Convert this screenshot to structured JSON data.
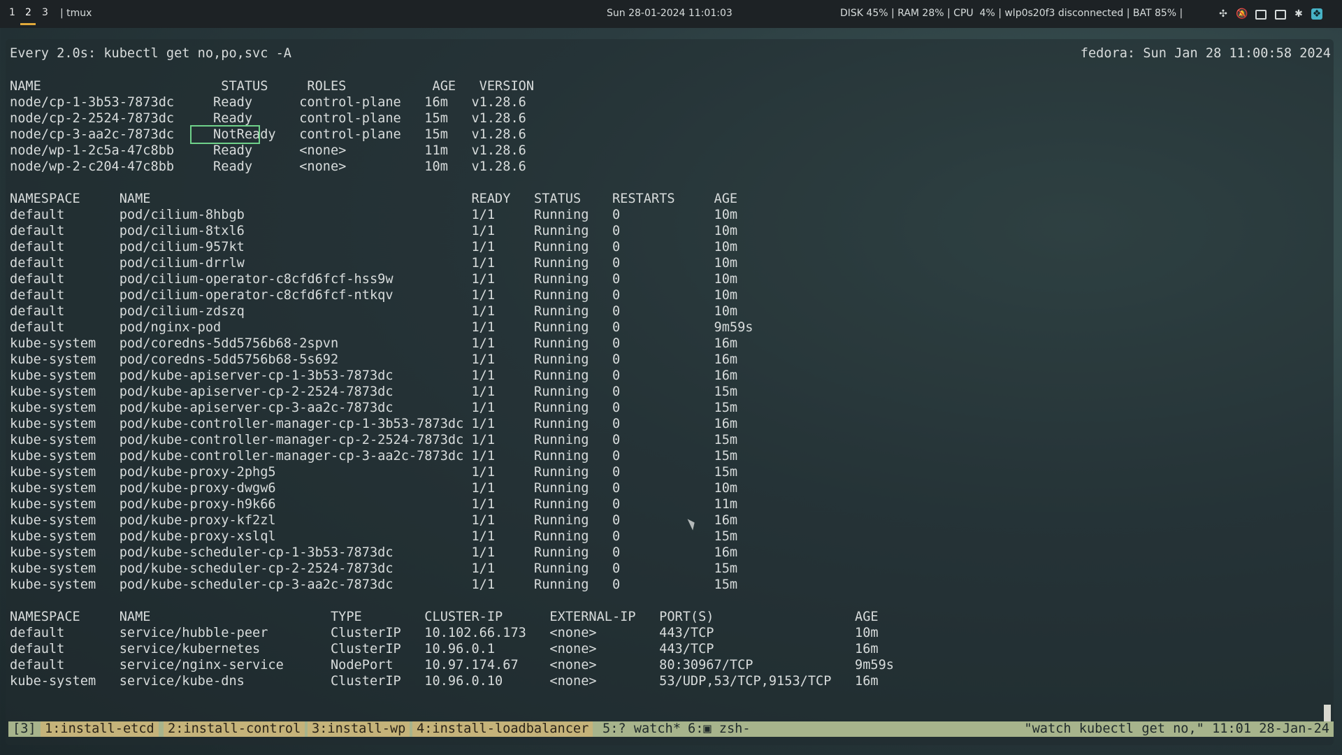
{
  "topbar": {
    "workspaces": [
      "1",
      "2",
      "3"
    ],
    "active_workspace": "2",
    "app_label": "| tmux",
    "clock": "Sun 28-01-2024 11:01:03",
    "status": "DISK 45% | RAM 28% | CPU  4% | wlp0s20f3 disconnected | BAT 85% |",
    "icons": [
      "fan-icon",
      "mute-icon",
      "window-icon",
      "window-alt-icon",
      "bluetooth-icon",
      "app-icon"
    ]
  },
  "terminal": {
    "header_left": "Every 2.0s: kubectl get no,po,svc -A",
    "header_right": "fedora: Sun Jan 28 11:00:58 2024",
    "nodes_header": "NAME                       STATUS     ROLES           AGE   VERSION",
    "nodes": [
      "node/cp-1-3b53-7873dc     Ready      control-plane   16m   v1.28.6",
      "node/cp-2-2524-7873dc     Ready      control-plane   15m   v1.28.6",
      "node/cp-3-aa2c-7873dc     NotReady   control-plane   15m   v1.28.6",
      "node/wp-1-2c5a-47c8bb     Ready      <none>          11m   v1.28.6",
      "node/wp-2-c204-47c8bb     Ready      <none>          10m   v1.28.6"
    ],
    "pods_header": "NAMESPACE     NAME                                         READY   STATUS    RESTARTS     AGE",
    "pods": [
      "default       pod/cilium-8hbgb                             1/1     Running   0            10m",
      "default       pod/cilium-8txl6                             1/1     Running   0            10m",
      "default       pod/cilium-957kt                             1/1     Running   0            10m",
      "default       pod/cilium-drrlw                             1/1     Running   0            10m",
      "default       pod/cilium-operator-c8cfd6fcf-hss9w          1/1     Running   0            10m",
      "default       pod/cilium-operator-c8cfd6fcf-ntkqv          1/1     Running   0            10m",
      "default       pod/cilium-zdszq                             1/1     Running   0            10m",
      "default       pod/nginx-pod                                1/1     Running   0            9m59s",
      "kube-system   pod/coredns-5dd5756b68-2spvn                 1/1     Running   0            16m",
      "kube-system   pod/coredns-5dd5756b68-5s692                 1/1     Running   0            16m",
      "kube-system   pod/kube-apiserver-cp-1-3b53-7873dc          1/1     Running   0            16m",
      "kube-system   pod/kube-apiserver-cp-2-2524-7873dc          1/1     Running   0            15m",
      "kube-system   pod/kube-apiserver-cp-3-aa2c-7873dc          1/1     Running   0            15m",
      "kube-system   pod/kube-controller-manager-cp-1-3b53-7873dc 1/1     Running   0            16m",
      "kube-system   pod/kube-controller-manager-cp-2-2524-7873dc 1/1     Running   0            15m",
      "kube-system   pod/kube-controller-manager-cp-3-aa2c-7873dc 1/1     Running   0            15m",
      "kube-system   pod/kube-proxy-2phg5                         1/1     Running   0            15m",
      "kube-system   pod/kube-proxy-dwgw6                         1/1     Running   0            10m",
      "kube-system   pod/kube-proxy-h9k66                         1/1     Running   0            11m",
      "kube-system   pod/kube-proxy-kf2zl                         1/1     Running   0            16m",
      "kube-system   pod/kube-proxy-xslql                         1/1     Running   0            15m",
      "kube-system   pod/kube-scheduler-cp-1-3b53-7873dc          1/1     Running   0            16m",
      "kube-system   pod/kube-scheduler-cp-2-2524-7873dc          1/1     Running   0            15m",
      "kube-system   pod/kube-scheduler-cp-3-aa2c-7873dc          1/1     Running   0            15m"
    ],
    "svc_header": "NAMESPACE     NAME                       TYPE        CLUSTER-IP      EXTERNAL-IP   PORT(S)                  AGE",
    "services": [
      "default       service/hubble-peer        ClusterIP   10.102.66.173   <none>        443/TCP                  10m",
      "default       service/kubernetes         ClusterIP   10.96.0.1       <none>        443/TCP                  16m",
      "default       service/nginx-service      NodePort    10.97.174.67    <none>        80:30967/TCP             9m59s",
      "kube-system   service/kube-dns           ClusterIP   10.96.0.10      <none>        53/UDP,53/TCP,9153/TCP   16m"
    ]
  },
  "tmux": {
    "session": "[3]",
    "windows": [
      "1:install-etcd",
      "2:install-control",
      "3:install-wp",
      "4:install-loadbalancer",
      "5:? watch*",
      "6:▣ zsh-"
    ],
    "right": "\"watch kubectl get no,\" 11:01 28-Jan-24"
  },
  "colors": {
    "highlight_border": "#6fd18a",
    "workspace_accent": "#e0a93a",
    "status_bg": "#a7b48c",
    "window_bg": "#c5b37a"
  }
}
